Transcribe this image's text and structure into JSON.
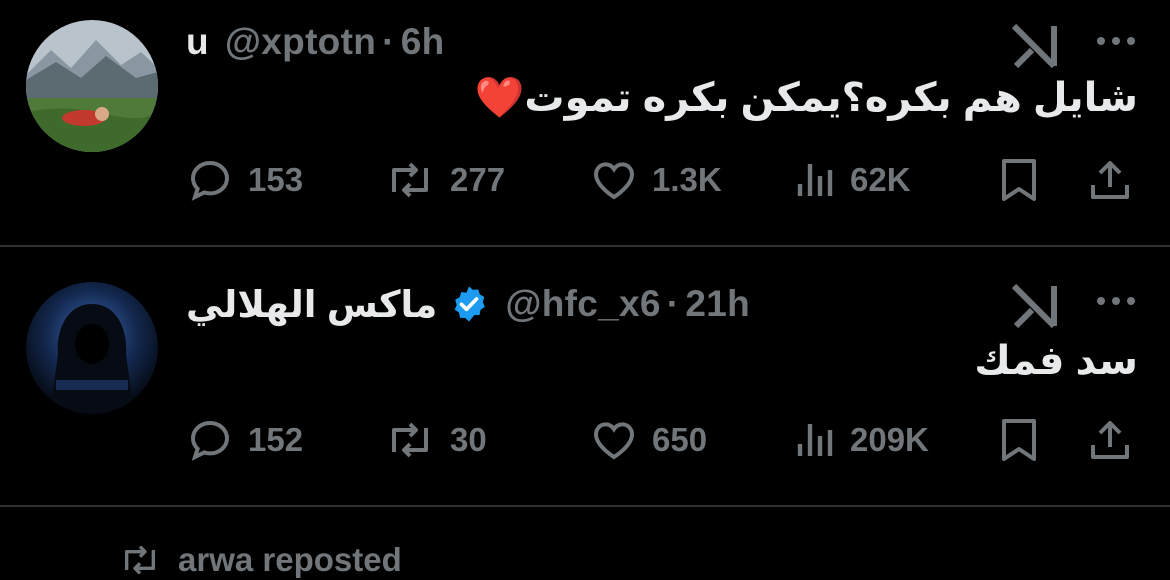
{
  "tweets": [
    {
      "name": "u",
      "handle": "@xptotn",
      "separator": "·",
      "time": "6h",
      "verified": false,
      "avatar": "avatar-landscape-mountains",
      "text": "شايل هم بكره؟يمكن بكره تموت❤️",
      "replies": "153",
      "reposts": "277",
      "likes": "1.3K",
      "views": "62K"
    },
    {
      "name": "ماكس الهلالي",
      "handle": "@hfc_x6",
      "separator": "·",
      "time": "21h",
      "verified": true,
      "avatar": "avatar-hooded-figure",
      "text": "سد فمك",
      "replies": "152",
      "reposts": "30",
      "likes": "650",
      "views": "209K"
    }
  ],
  "next_item": {
    "label": "arwa reposted"
  },
  "colors": {
    "background": "#000000",
    "primary_text": "#e7e9ea",
    "secondary_text": "#71767b",
    "divider": "#2f3336",
    "verified_badge": "#1d9bf0"
  },
  "icons": [
    "reply-icon",
    "repost-icon",
    "like-icon",
    "views-icon",
    "bookmark-icon",
    "share-icon",
    "grok-icon",
    "more-icon",
    "verified-icon"
  ]
}
